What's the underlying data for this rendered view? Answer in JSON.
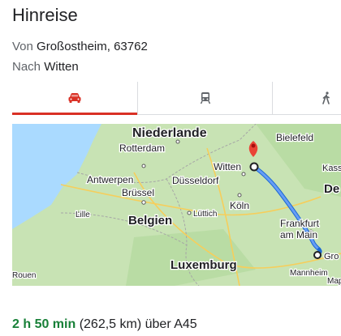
{
  "title": "Hinreise",
  "route": {
    "from_label": "Von",
    "from_value": "Großostheim, 63762",
    "to_label": "Nach",
    "to_value": "Witten"
  },
  "tabs": [
    {
      "icon": "car-icon",
      "selected": true
    },
    {
      "icon": "train-icon",
      "selected": false
    },
    {
      "icon": "walking-icon",
      "selected": false
    }
  ],
  "map": {
    "labels": {
      "niederlande": "Niederlande",
      "rotterdam": "Rotterdam",
      "antwerpen": "Antwerpen",
      "brussel": "Brüssel",
      "belgien": "Belgien",
      "lille": "Lille",
      "duesseldorf": "Düsseldorf",
      "witten": "Witten",
      "bielefeld": "Bielefeld",
      "kass": "Kass",
      "de": "De",
      "koeln": "Köln",
      "luettich": "Lüttich",
      "frankfurt": "Frankfurt",
      "am_main": "am Main",
      "gro": "Gro",
      "luxemburg": "Luxemburg",
      "rouen": "Rouen",
      "mannheim": "Mannheim",
      "map_cut": "Map"
    },
    "colors": {
      "water": "#aadaff",
      "land": "#c8e3b4",
      "route": "#4285f4",
      "pin": "#ea4335"
    }
  },
  "summary": {
    "duration": "2 h 50 min",
    "distance": "(262,5 km)",
    "via": "über A45"
  },
  "colors": {
    "accent": "#d93025",
    "duration": "#188038"
  }
}
